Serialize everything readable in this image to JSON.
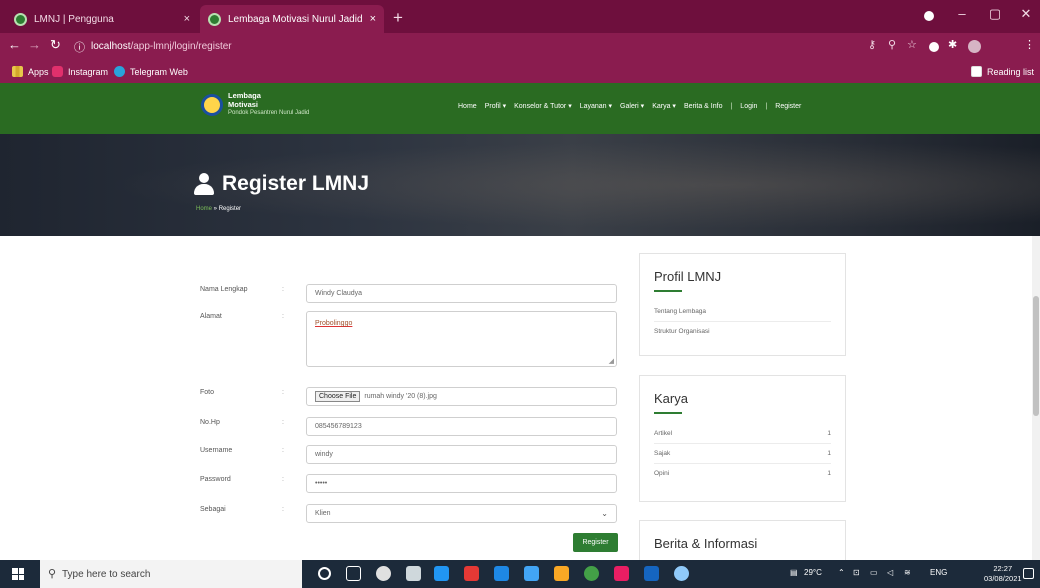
{
  "browser": {
    "tabs": [
      {
        "title": "LMNJ | Pengguna",
        "close": "×"
      },
      {
        "title": "Lembaga Motivasi Nurul Jadid - L",
        "close": "×"
      }
    ],
    "new_tab": "+",
    "url_host": "localhost",
    "url_path": "/app-lmnj/login/register",
    "bookmarks": [
      "Apps",
      "Instagram",
      "Telegram Web"
    ],
    "reading_list": "Reading list"
  },
  "site": {
    "logo_line1": "Lembaga",
    "logo_line2": "Motivasi",
    "logo_line3": "Pondok Pesantren Nurul Jadid",
    "nav": [
      "Home",
      "Profil ▾",
      "Konselor & Tutor ▾",
      "Layanan ▾",
      "Galeri ▾",
      "Karya ▾",
      "Berita & Info",
      "|",
      "Login",
      "|",
      "Register"
    ]
  },
  "hero": {
    "title": "Register LMNJ",
    "breadcrumb_home": "Home",
    "breadcrumb_sep": " » ",
    "breadcrumb_current": "Register"
  },
  "form": {
    "colon": ":",
    "fields": [
      {
        "label": "Nama Lengkap",
        "value": "Windy Claudya"
      },
      {
        "label": "Alamat",
        "value": "Probolinggo"
      },
      {
        "label": "Foto",
        "button": "Choose File",
        "value": "rumah windy '20 (8).jpg"
      },
      {
        "label": "No.Hp",
        "value": "085456789123"
      },
      {
        "label": "Username",
        "value": "windy"
      },
      {
        "label": "Password",
        "value": "•••••"
      },
      {
        "label": "Sebagai",
        "value": "Klien"
      }
    ],
    "submit": "Register"
  },
  "sidebar": {
    "profil": {
      "title": "Profil LMNJ",
      "items": [
        "Tentang Lembaga",
        "Struktur Organisasi"
      ]
    },
    "karya": {
      "title": "Karya",
      "items": [
        {
          "label": "Artikel",
          "count": "1"
        },
        {
          "label": "Sajak",
          "count": "1"
        },
        {
          "label": "Opini",
          "count": "1"
        }
      ]
    },
    "berita": {
      "title": "Berita & Informasi"
    }
  },
  "taskbar": {
    "search_placeholder": "Type here to search",
    "weather": "29°C",
    "lang": "ENG",
    "time": "22:27",
    "date": "03/08/2021"
  },
  "colors": {
    "browser_frame": "#8a1c4f",
    "site_green": "#2a6b22",
    "accent_green": "#2e7d32"
  }
}
